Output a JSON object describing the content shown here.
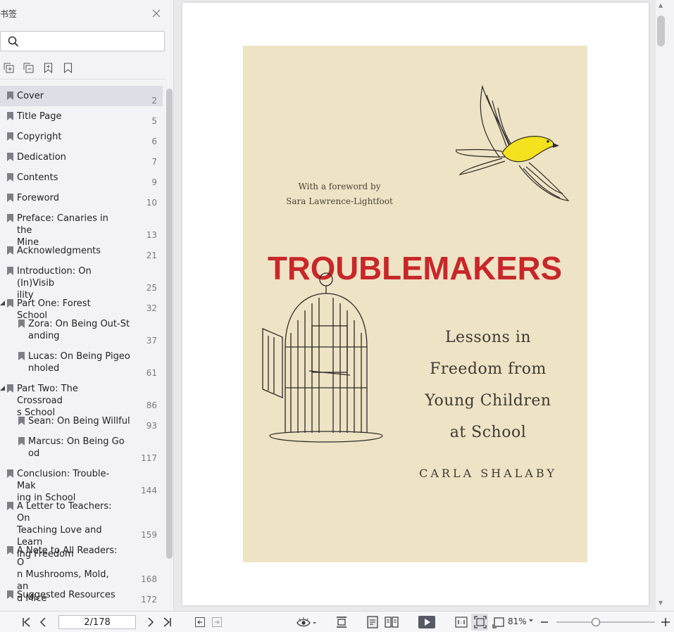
{
  "sidebar": {
    "title": "书签",
    "search_placeholder": "",
    "bookmarks": [
      {
        "label": "Cover",
        "page": "2",
        "level": 0,
        "selected": true
      },
      {
        "label": "Title Page",
        "page": "5",
        "level": 0
      },
      {
        "label": "Copyright",
        "page": "6",
        "level": 0
      },
      {
        "label": "Dedication",
        "page": "7",
        "level": 0
      },
      {
        "label": "Contents",
        "page": "9",
        "level": 0
      },
      {
        "label": "Foreword",
        "page": "10",
        "level": 0
      },
      {
        "label": "Preface: Canaries in the\nMine",
        "page": "13",
        "level": 0
      },
      {
        "label": "Acknowledgments",
        "page": "21",
        "level": 0
      },
      {
        "label": "Introduction: On (In)Visib\nility",
        "page": "25",
        "level": 0
      },
      {
        "label": "Part One: Forest School",
        "page": "32",
        "level": 0,
        "expanded": true
      },
      {
        "label": "Zora: On Being Out-St\nanding",
        "page": "37",
        "level": 1
      },
      {
        "label": "Lucas: On Being Pigeo\nnholed",
        "page": "61",
        "level": 1
      },
      {
        "label": "Part Two: The Crossroad\ns School",
        "page": "86",
        "level": 0,
        "expanded": true
      },
      {
        "label": "Sean: On Being Willful",
        "page": "93",
        "level": 1
      },
      {
        "label": "Marcus: On Being Go\nod",
        "page": "117",
        "level": 1
      },
      {
        "label": "Conclusion: Trouble-Mak\ning in School",
        "page": "144",
        "level": 0
      },
      {
        "label": "A Letter to Teachers: On\nTeaching Love and Learn\ning Freedom",
        "page": "159",
        "level": 0
      },
      {
        "label": "A Note to All Readers: O\nn Mushrooms, Mold, an\nd Mice",
        "page": "168",
        "level": 0
      },
      {
        "label": "Suggested Resources",
        "page": "172",
        "level": 0
      }
    ]
  },
  "cover": {
    "foreword_line1": "With a foreword by",
    "foreword_line2": "Sara Lawrence-Lightfoot",
    "title": "TROUBLEMAKERS",
    "subtitle_line1": "Lessons in",
    "subtitle_line2": "Freedom from",
    "subtitle_line3": "Young Children",
    "subtitle_line4": "at School",
    "author": "CARLA SHALABY",
    "colors": {
      "background": "#efe3c5",
      "title": "#c8272a",
      "bird": "#f3e21d"
    }
  },
  "toolbar": {
    "page_value": "2/178",
    "zoom_level": "81%",
    "zoom_fraction": 0.4
  }
}
